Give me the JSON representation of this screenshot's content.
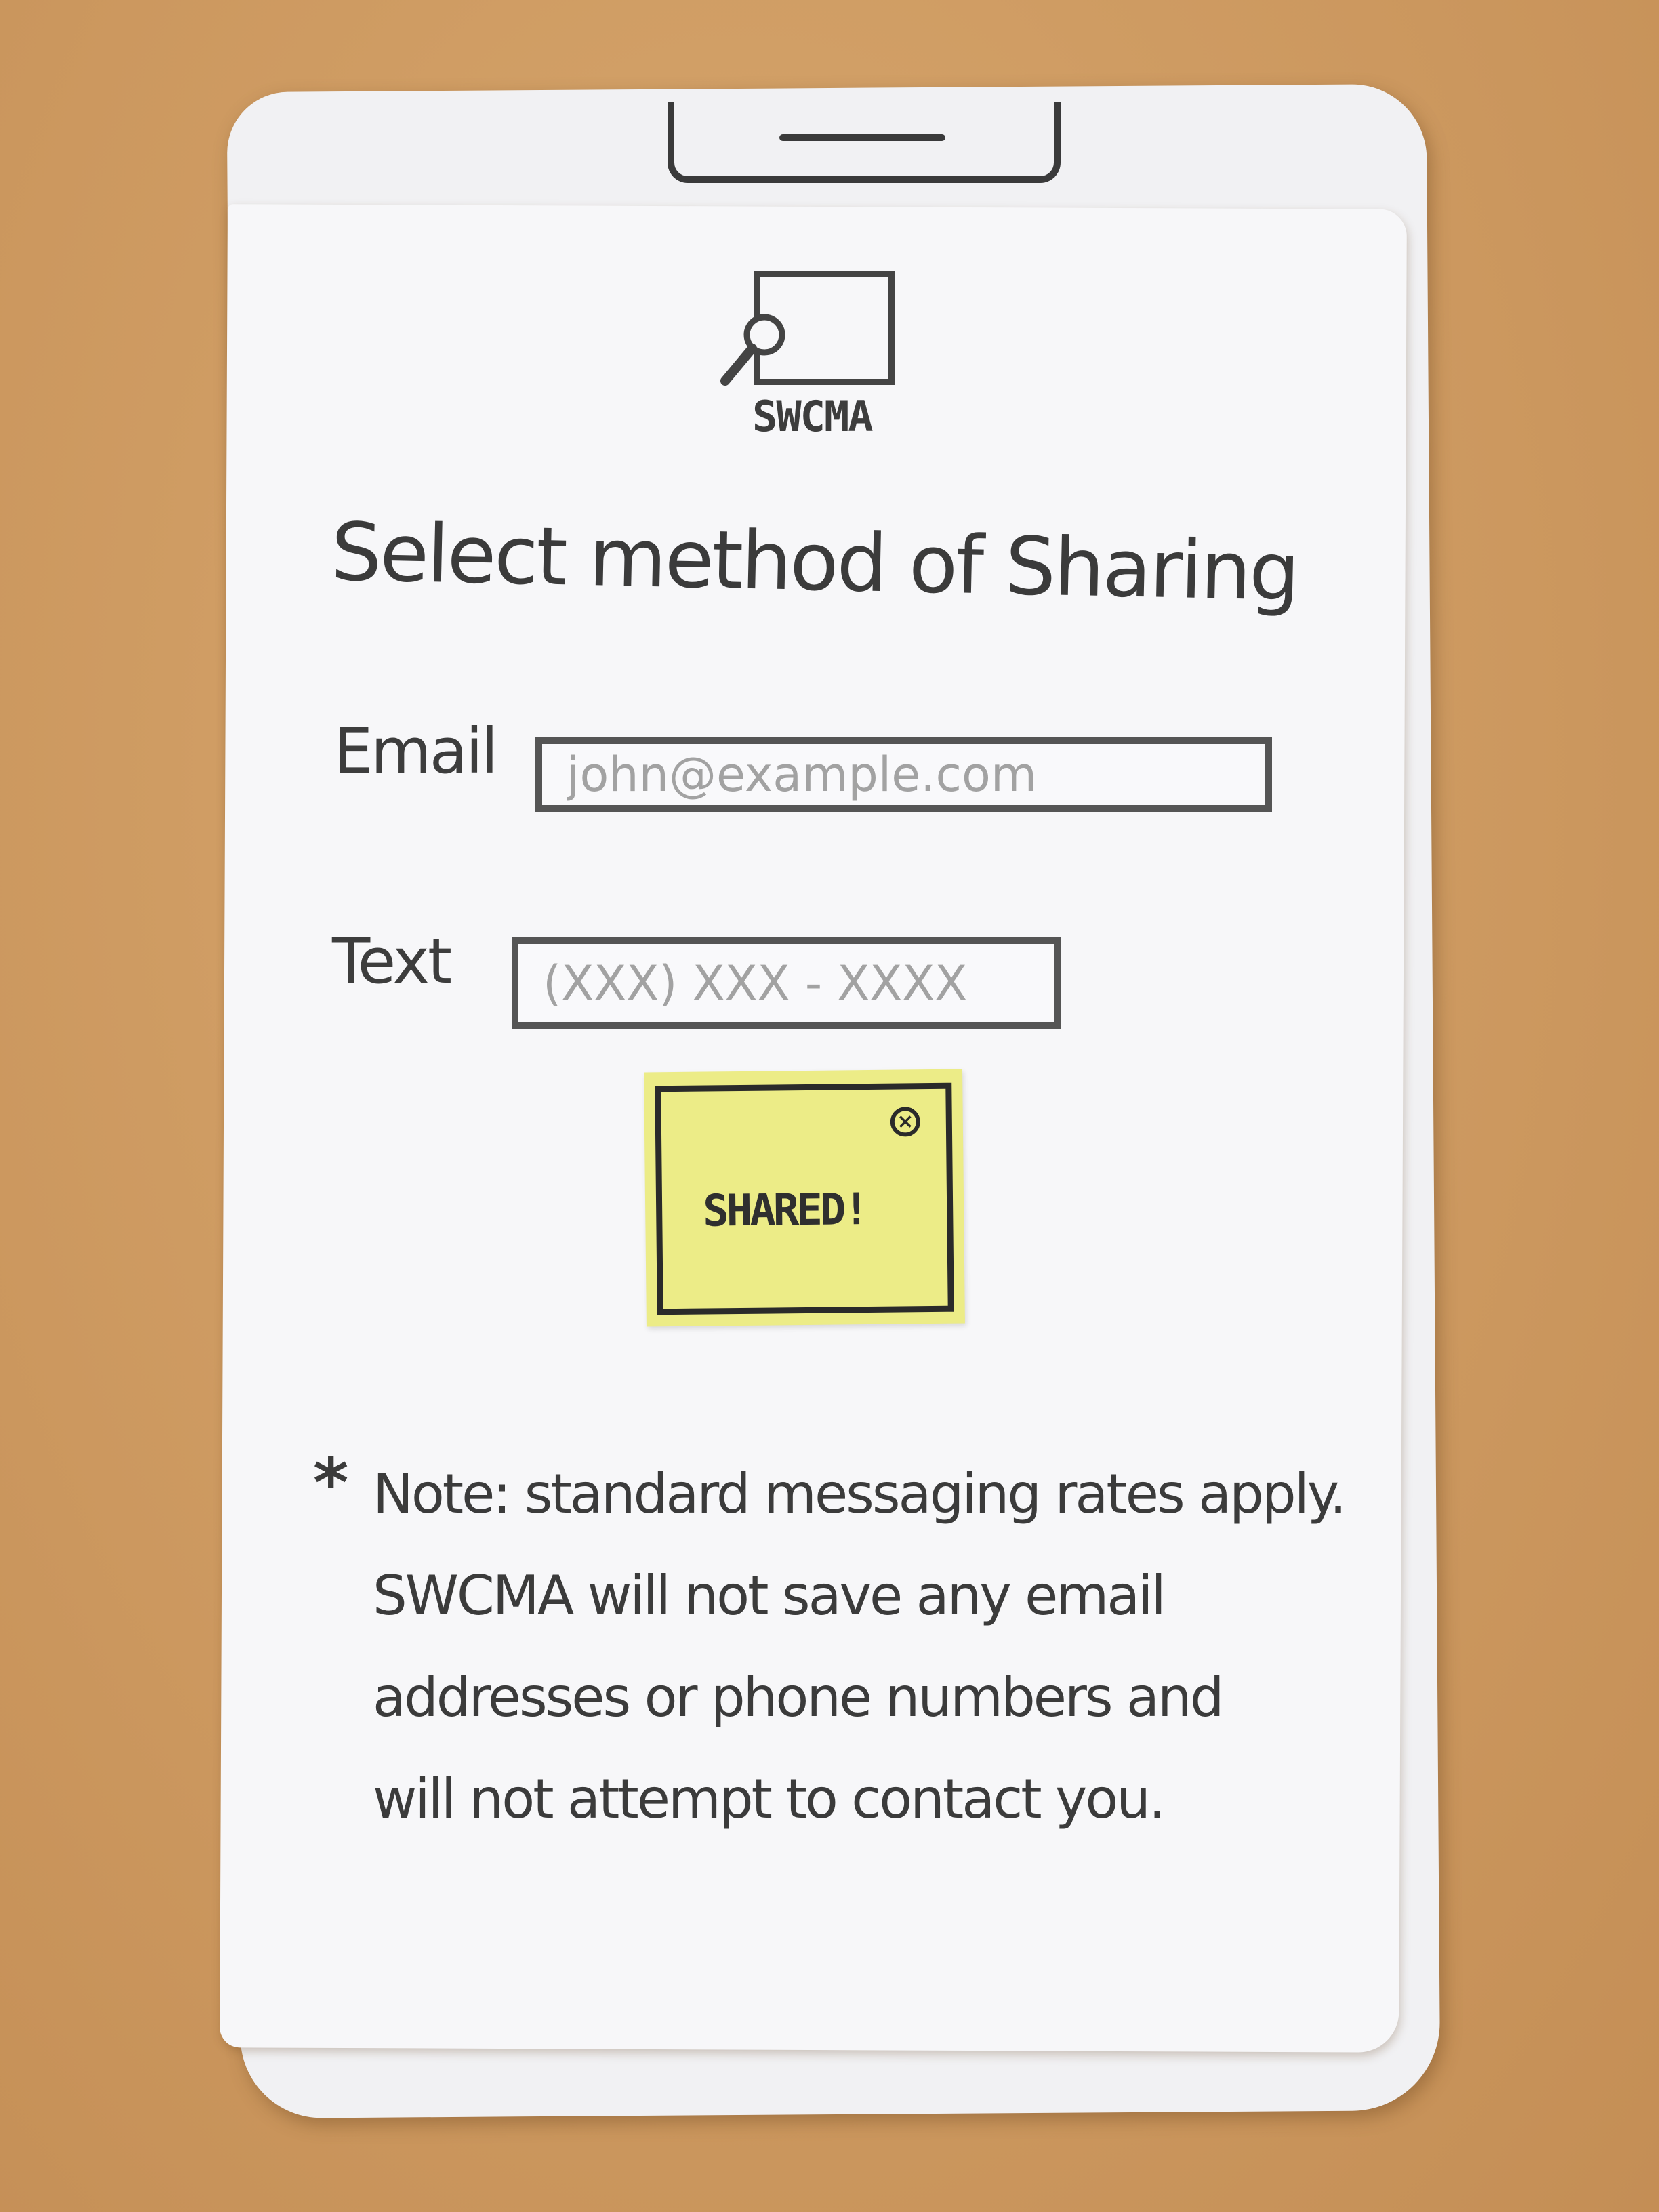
{
  "app": {
    "logo_text": "SWCMA"
  },
  "screen": {
    "title": "Select method of Sharing"
  },
  "share_form": {
    "email_label": "Email",
    "email_placeholder": "john@example.com",
    "text_label": "Text",
    "text_placeholder": "(XXX) XXX - XXXX"
  },
  "toast": {
    "message": "SHARED!",
    "close_icon": "close-circle-icon"
  },
  "note": {
    "asterisk": "*",
    "lines": [
      "Note: standard messaging rates apply.",
      "SWCMA will not save any email",
      "addresses or phone numbers and",
      "will not attempt to contact you."
    ]
  },
  "colors": {
    "ink": "#3b3b3b",
    "sticky_note": "#ecec87",
    "paper": "#f7f7f9",
    "desk": "#cf9c63"
  }
}
